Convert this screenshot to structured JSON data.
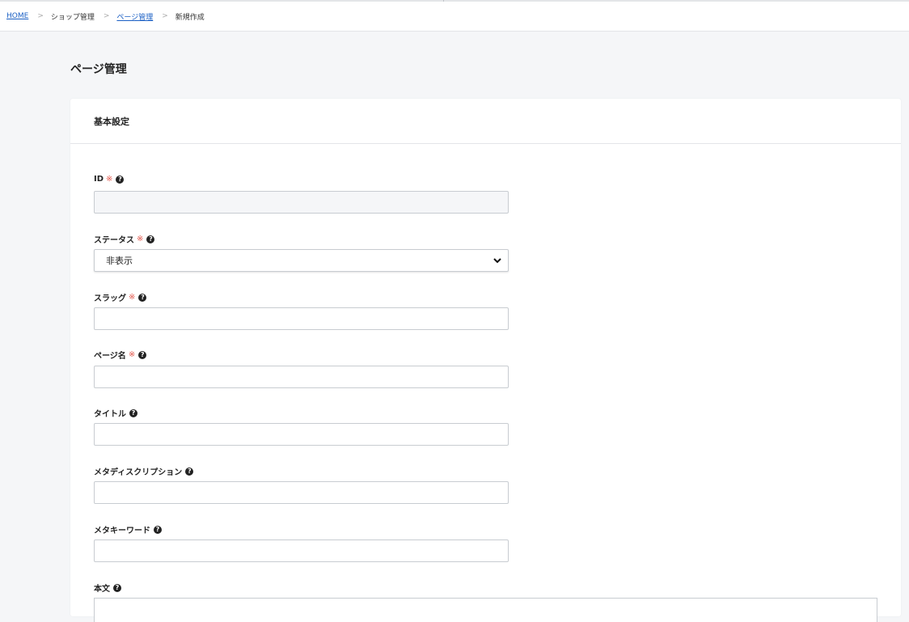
{
  "breadcrumb": {
    "items": [
      {
        "label": "HOME",
        "link": true
      },
      {
        "label": "ショップ管理",
        "link": false
      },
      {
        "label": "ページ管理",
        "link": true
      },
      {
        "label": "新規作成",
        "link": false
      }
    ],
    "separator": ">"
  },
  "page": {
    "title": "ページ管理"
  },
  "card": {
    "title": "基本設定"
  },
  "form": {
    "required_mark": "※",
    "help_icon": "?",
    "fields": {
      "id": {
        "label": "ID",
        "value": "",
        "required": true
      },
      "status": {
        "label": "ステータス",
        "value": "非表示",
        "required": true
      },
      "slug": {
        "label": "スラッグ",
        "value": "",
        "required": true
      },
      "page_name": {
        "label": "ページ名",
        "value": "",
        "required": true
      },
      "title": {
        "label": "タイトル",
        "value": "",
        "required": false
      },
      "meta_description": {
        "label": "メタディスクリプション",
        "value": "",
        "required": false
      },
      "meta_keywords": {
        "label": "メタキーワード",
        "value": "",
        "required": false
      },
      "body": {
        "label": "本文",
        "value": "",
        "required": false
      }
    }
  },
  "colors": {
    "link": "#1a5fc4",
    "required": "#e2574c",
    "background": "#f5f6f8"
  }
}
